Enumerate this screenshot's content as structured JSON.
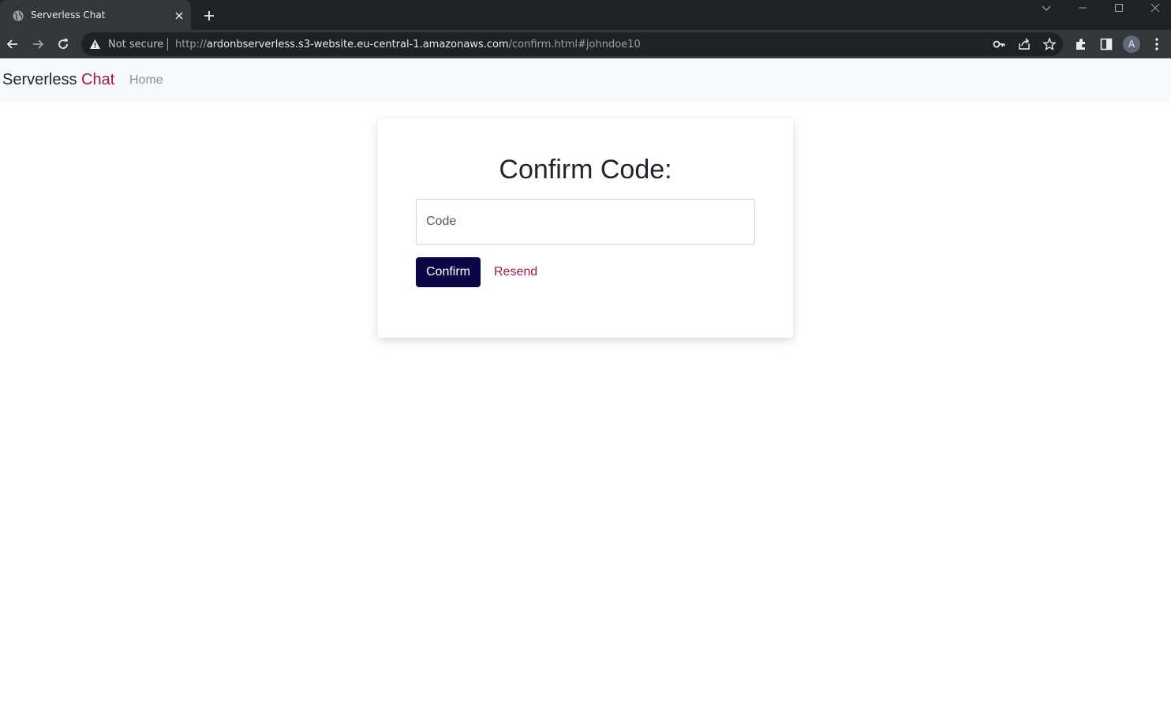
{
  "browser": {
    "tab_title": "Serverless Chat",
    "security_label": "Not secure",
    "url": {
      "scheme": "http://",
      "host": "ardonbserverless.s3-website.eu-central-1.amazonaws.com",
      "path": "/confirm.html#johndoe10"
    },
    "profile_initial": "A"
  },
  "navbar": {
    "brand_primary": "Serverless",
    "brand_accent": "Chat",
    "home_link": "Home"
  },
  "confirm_form": {
    "title": "Confirm Code:",
    "code_value": "",
    "code_placeholder": "Code",
    "confirm_label": "Confirm",
    "resend_label": "Resend"
  },
  "colors": {
    "brand_accent": "#a0174f",
    "primary_button": "#0b0545",
    "navbar_bg": "#f8f9fa"
  }
}
